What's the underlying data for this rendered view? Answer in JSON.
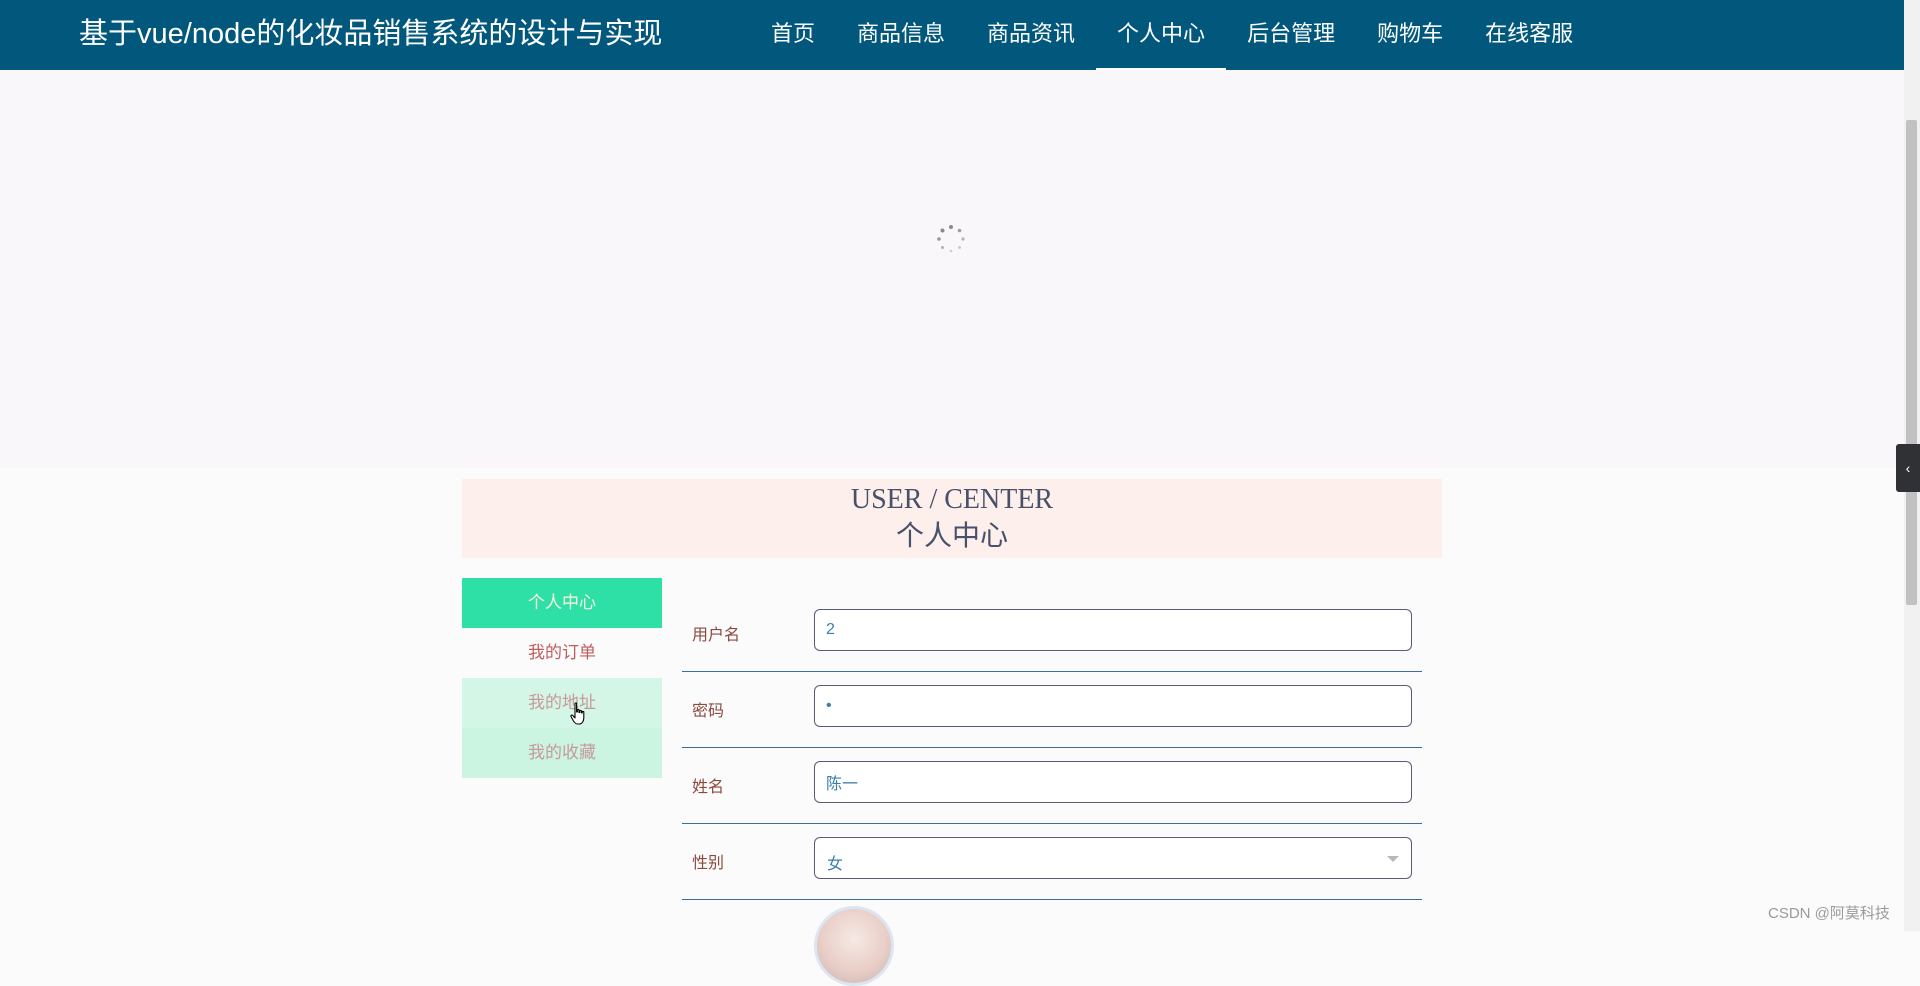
{
  "header": {
    "site_title": "基于vue/node的化妆品销售系统的设计与实现",
    "nav": [
      {
        "label": "首页"
      },
      {
        "label": "商品信息"
      },
      {
        "label": "商品资讯"
      },
      {
        "label": "个人中心",
        "active": true
      },
      {
        "label": "后台管理"
      },
      {
        "label": "购物车"
      },
      {
        "label": "在线客服"
      }
    ]
  },
  "section": {
    "title_en": "USER / CENTER",
    "title_cn": "个人中心"
  },
  "side_menu": [
    {
      "label": "个人中心",
      "state": "active"
    },
    {
      "label": "我的订单",
      "state": "normal"
    },
    {
      "label": "我的地址",
      "state": "hover"
    },
    {
      "label": "我的收藏",
      "state": "soft"
    }
  ],
  "form": {
    "username": {
      "label": "用户名",
      "value": "2"
    },
    "password": {
      "label": "密码",
      "value": "•"
    },
    "name": {
      "label": "姓名",
      "value": "陈一"
    },
    "gender": {
      "label": "性别",
      "value": "女"
    }
  },
  "watermark": "CSDN @阿莫科技",
  "colors": {
    "header_bg": "#02587c",
    "menu_active_bg": "#2ee0a6",
    "section_head_bg": "#fcefec"
  }
}
